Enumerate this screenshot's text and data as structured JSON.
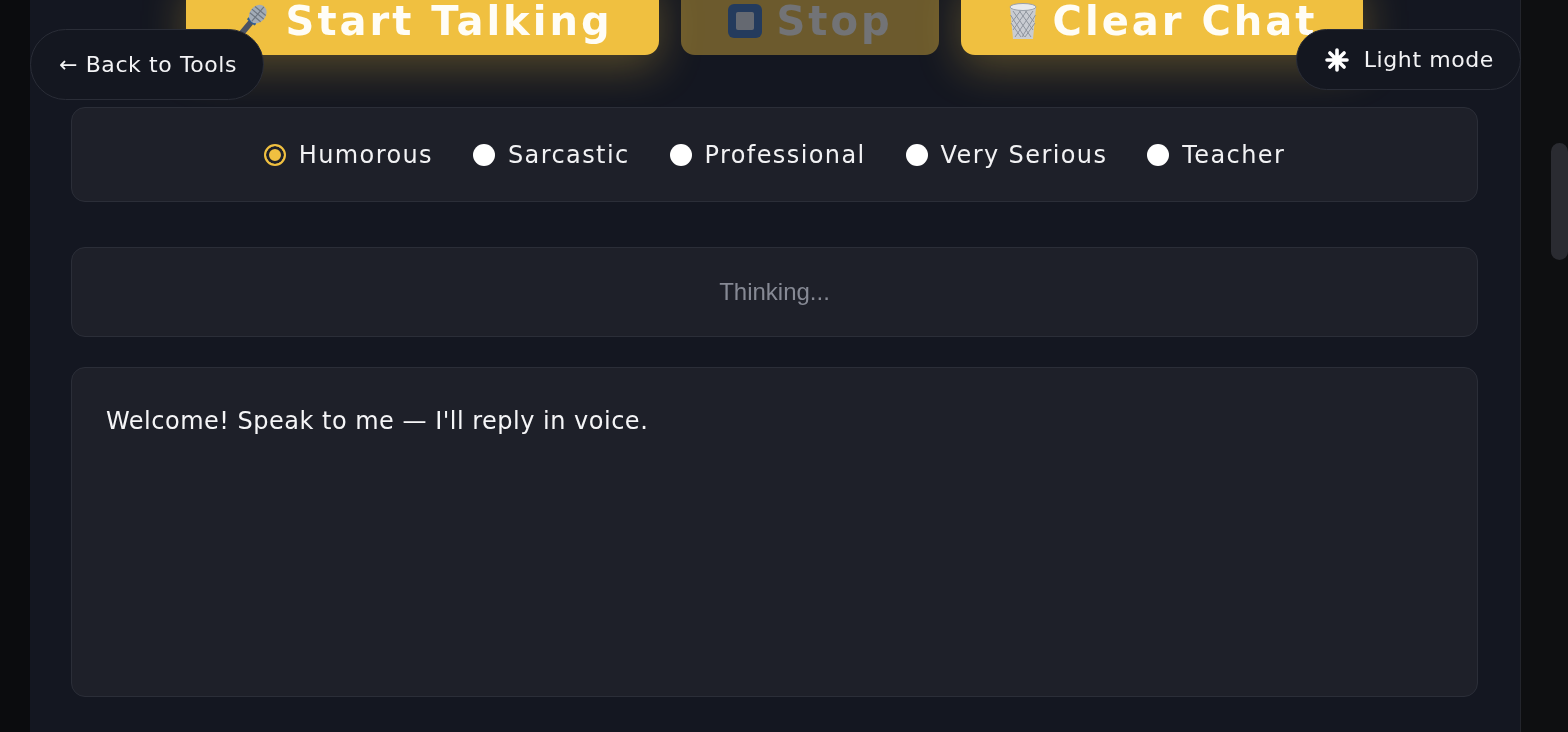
{
  "back_button": {
    "label": "← Back to Tools"
  },
  "theme_toggle": {
    "label": "Light mode"
  },
  "controls": [
    {
      "kind": "start",
      "label": "Start Talking",
      "disabled": false
    },
    {
      "kind": "stop",
      "label": "Stop",
      "disabled": true
    },
    {
      "kind": "clear",
      "label": "Clear Chat",
      "disabled": false
    }
  ],
  "tones": [
    {
      "label": "Humorous",
      "selected": true
    },
    {
      "label": "Sarcastic",
      "selected": false
    },
    {
      "label": "Professional",
      "selected": false
    },
    {
      "label": "Very Serious",
      "selected": false
    },
    {
      "label": "Teacher",
      "selected": false
    }
  ],
  "status": {
    "text": "Thinking..."
  },
  "chat": {
    "messages": [
      {
        "text": "Welcome! Speak to me — I'll reply in voice."
      }
    ]
  }
}
